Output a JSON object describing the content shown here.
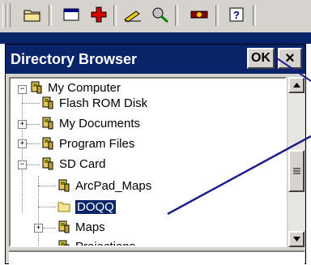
{
  "toolbar": {
    "icons": [
      "open-folder-icon",
      "window-icon",
      "add-icon",
      "edit-icon",
      "tools-icon",
      "gps-icon",
      "help-icon"
    ]
  },
  "dialog": {
    "title": "Directory Browser",
    "ok_label": "OK",
    "close_label": "×"
  },
  "tree": {
    "items": [
      {
        "label": "My Computer",
        "expander": "−"
      },
      {
        "label": "Flash ROM Disk",
        "expander": ""
      },
      {
        "label": "My Documents",
        "expander": "+"
      },
      {
        "label": "Program Files",
        "expander": "+"
      },
      {
        "label": "SD Card",
        "expander": "−"
      },
      {
        "label": "ArcPad_Maps",
        "expander": ""
      },
      {
        "label": "DOQQ",
        "expander": "",
        "selected": true
      },
      {
        "label": "Maps",
        "expander": "+"
      },
      {
        "label": "Projections",
        "expander": ""
      }
    ]
  },
  "colors": {
    "titlebar": "#0a246a",
    "face": "#d6d3ce",
    "annotation": "#1c1c8c"
  }
}
